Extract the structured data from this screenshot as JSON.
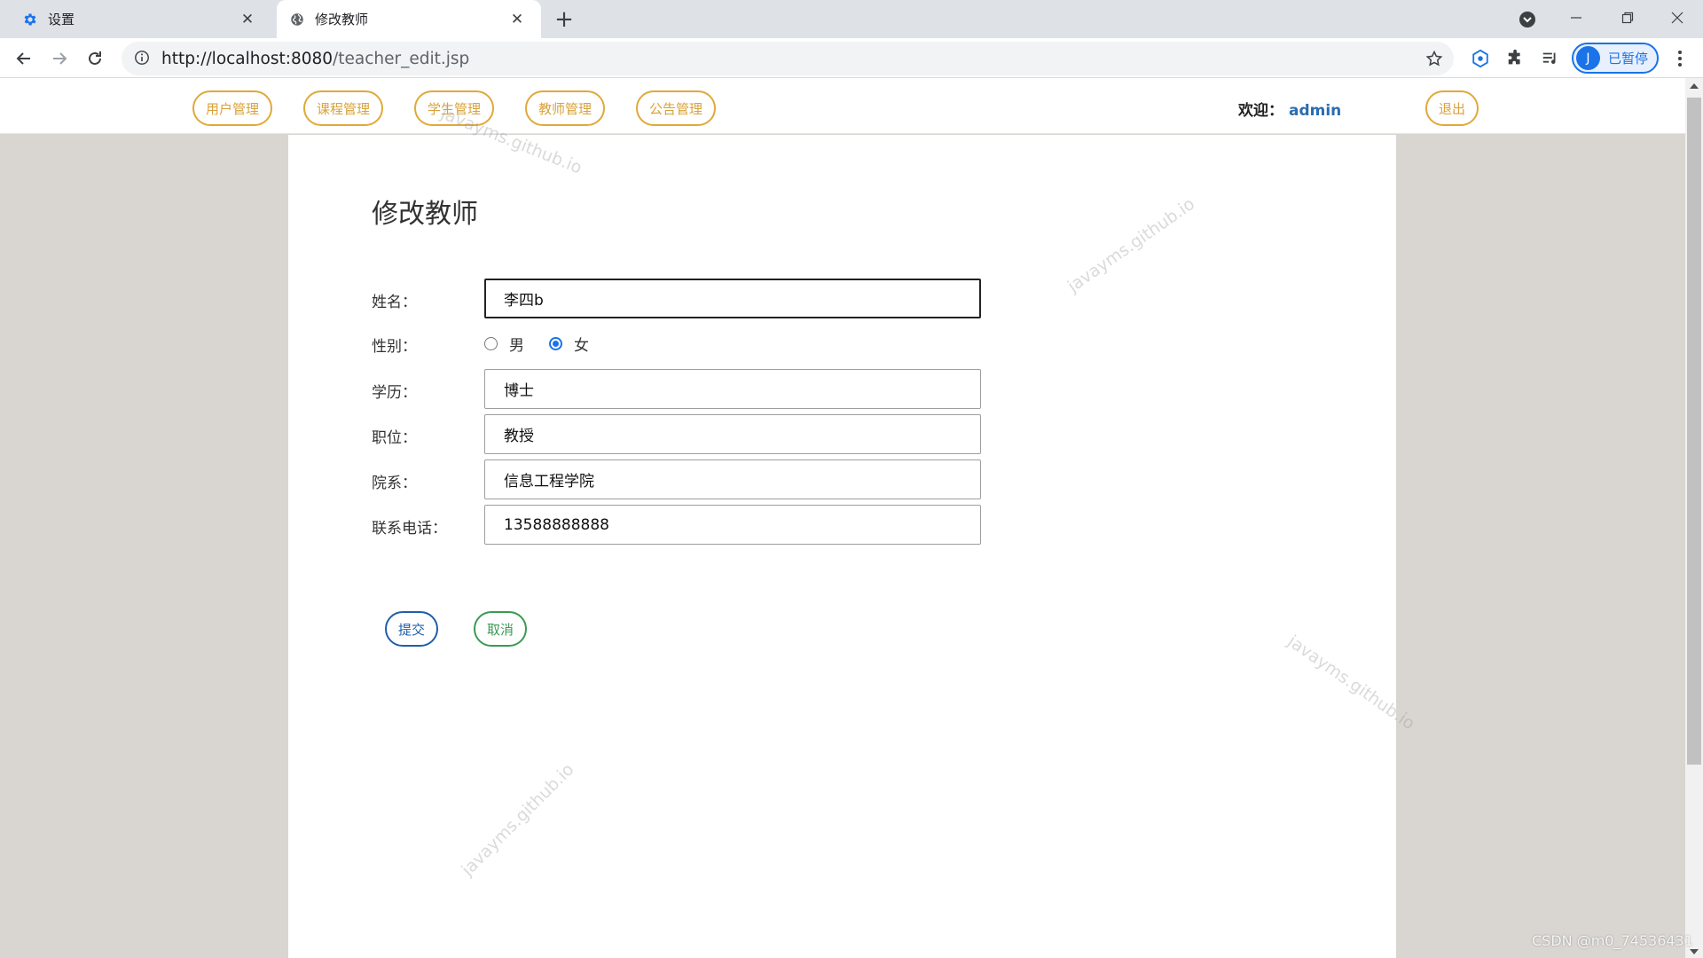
{
  "browser": {
    "tabs": [
      {
        "title": "设置",
        "icon": "gear-icon"
      },
      {
        "title": "修改教师",
        "icon": "globe-icon"
      }
    ],
    "url_host": "http://localhost:8080",
    "url_path": "/teacher_edit.jsp",
    "profile": {
      "initial": "J",
      "status": "已暂停"
    }
  },
  "nav": {
    "items": [
      "用户管理",
      "课程管理",
      "学生管理",
      "教师管理",
      "公告管理"
    ],
    "welcome_label": "欢迎：",
    "username": "admin",
    "logout": "退出"
  },
  "form": {
    "title": "修改教师",
    "name_label": "姓名：",
    "name_value": "李四b",
    "gender_label": "性别：",
    "gender_options": [
      "男",
      "女"
    ],
    "gender_selected": "女",
    "education_label": "学历：",
    "education_value": "博士",
    "position_label": "职位：",
    "position_value": "教授",
    "department_label": "院系：",
    "department_value": "信息工程学院",
    "phone_label": "联系电话：",
    "phone_value": "13588888888",
    "submit": "提交",
    "cancel": "取消"
  },
  "watermark": "javayms.github.io",
  "credit": "CSDN @m0_74536431",
  "colors": {
    "nav_pill": "#e0a93a",
    "submit": "#1f5ea8",
    "cancel": "#3a9a52",
    "username": "#2b6cb0",
    "radio_selected": "#1a73e8"
  }
}
